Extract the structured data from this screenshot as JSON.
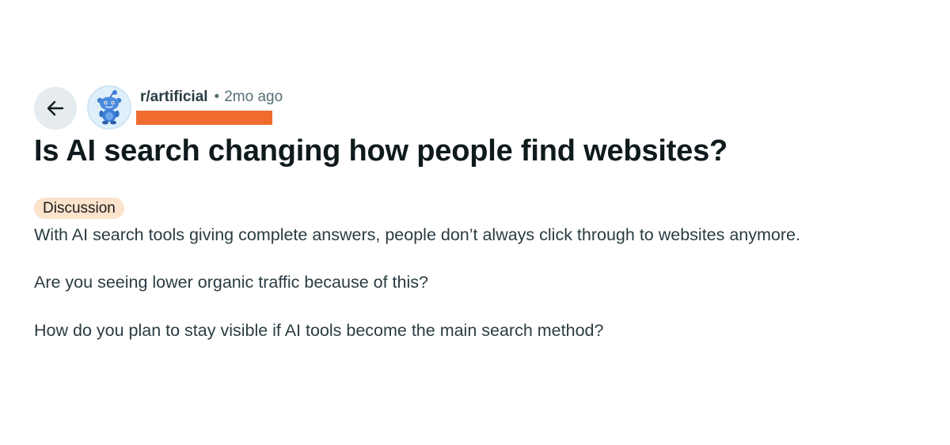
{
  "post": {
    "subreddit": "r/artificial",
    "separator": "•",
    "time_ago": "2mo ago",
    "title": "Is AI search changing how people find websites?",
    "flair": "Discussion",
    "paragraphs": [
      "With AI search tools giving complete answers, people don’t always click through to websites anymore.",
      "Are you seeing lower organic traffic because of this?",
      "How do you plan to stay visible if AI tools become the main search method?"
    ]
  },
  "icons": {
    "back": "arrow-left-icon",
    "avatar": "reddit-snoo-avatar"
  },
  "colors": {
    "redaction": "#ef6c2e",
    "flair_bg": "#fbe3cc",
    "back_button_bg": "#e5ebee"
  }
}
